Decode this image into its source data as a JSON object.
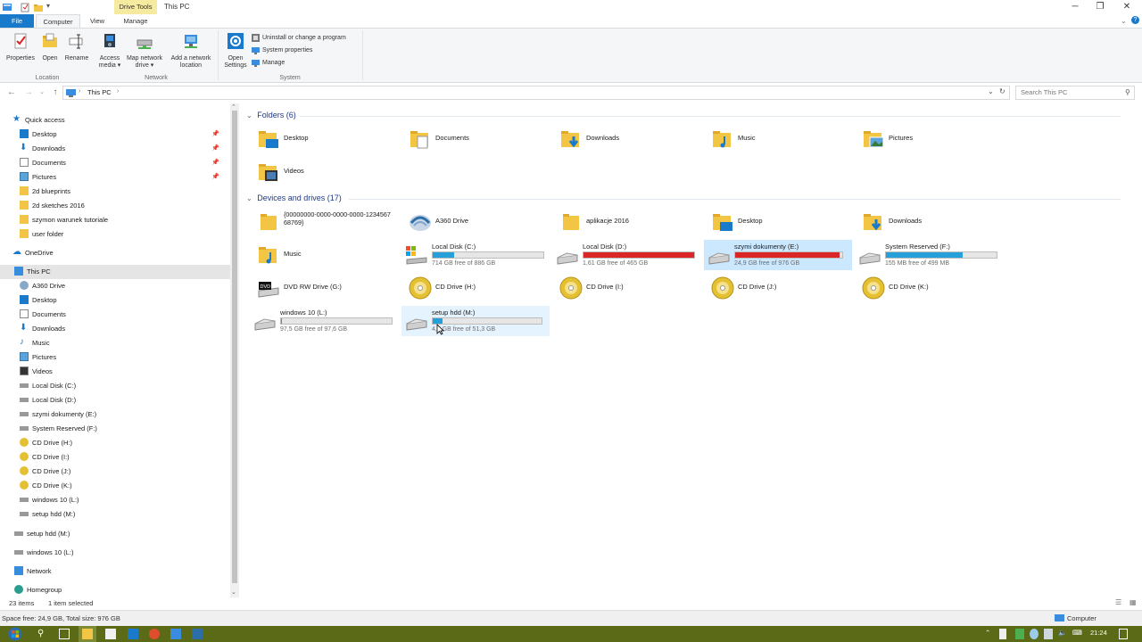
{
  "window": {
    "title": "This PC",
    "context_tab": "Drive Tools",
    "controls": [
      "─",
      "❐",
      "✕"
    ]
  },
  "ribbon_tabs": [
    "File",
    "Computer",
    "View",
    "Manage"
  ],
  "ribbon": {
    "buttons": [
      {
        "label": "Properties"
      },
      {
        "label": "Open"
      },
      {
        "label": "Rename"
      },
      {
        "label": "Access media ▾"
      },
      {
        "label": "Map network drive ▾"
      },
      {
        "label": "Add a network location"
      },
      {
        "label": "Open Settings"
      }
    ],
    "small": [
      "Uninstall or change a program",
      "System properties",
      "Manage"
    ],
    "groups": [
      "Location",
      "Network",
      "System"
    ]
  },
  "address": {
    "crumb": "This PC",
    "search_placeholder": "Search This PC"
  },
  "sidebar": {
    "quick_access": "Quick access",
    "quick_items": [
      "Desktop",
      "Downloads",
      "Documents",
      "Pictures",
      "2d blueprints",
      "2d sketches 2016",
      "szymon warunek tutoriale",
      "user folder"
    ],
    "onedrive": "OneDrive",
    "this_pc": "This PC",
    "pc_items": [
      "A360 Drive",
      "Desktop",
      "Documents",
      "Downloads",
      "Music",
      "Pictures",
      "Videos",
      "Local Disk (C:)",
      "Local Disk (D:)",
      "szymi dokumenty (E:)",
      "System Reserved (F:)",
      "CD Drive (H:)",
      "CD Drive (I:)",
      "CD Drive (J:)",
      "CD Drive (K:)",
      "windows 10 (L:)",
      "setup hdd (M:)"
    ],
    "extra_items": [
      "setup hdd (M:)",
      "windows 10 (L:)"
    ],
    "network": "Network",
    "homegroup": "Homegroup"
  },
  "folders": {
    "heading": "Folders (6)",
    "items": [
      "Desktop",
      "Documents",
      "Downloads",
      "Music",
      "Pictures",
      "Videos"
    ]
  },
  "devices": {
    "heading": "Devices and drives (17)",
    "row1": [
      "{00000000-0000-0000-0000-123456768769}",
      "A360 Drive",
      "aplikacje 2016",
      "Desktop",
      "Downloads"
    ],
    "row1_label1": "{00000000-0000-0000-0000-1234567",
    "row1_label1b": "68769}",
    "music": "Music",
    "drives": [
      {
        "name": "Local Disk (C:)",
        "free": "714 GB free of 886 GB",
        "used": 0.19,
        "color": "#26a0da"
      },
      {
        "name": "Local Disk (D:)",
        "free": "1,61 GB free of 465 GB",
        "used": 0.997,
        "color": "#da2626"
      },
      {
        "name": "szymi dokumenty (E:)",
        "free": "24,9 GB free of 976 GB",
        "used": 0.975,
        "color": "#da2626"
      },
      {
        "name": "System Reserved (F:)",
        "free": "155 MB free of 499 MB",
        "used": 0.69,
        "color": "#26a0da"
      },
      {
        "name": "windows 10 (L:)",
        "free": "97,5 GB free of 97,6 GB",
        "used": 0.001,
        "color": "#26a0da"
      },
      {
        "name": "setup hdd (M:)",
        "free": "4,6 GB free of 51,3 GB",
        "used": 0.09,
        "color": "#26a0da"
      }
    ],
    "dvd": "DVD RW Drive (G:)",
    "cds": [
      "CD Drive (H:)",
      "CD Drive (I:)",
      "CD Drive (J:)",
      "CD Drive (K:)"
    ]
  },
  "status": {
    "items": "23 items",
    "selected": "1 item selected"
  },
  "details": {
    "left": "Space free: 24,9 GB, Total size: 976 GB",
    "right": "Computer"
  },
  "taskbar": {
    "clock": "21:24"
  },
  "colors": {
    "accent": "#1979ca",
    "bar_blue": "#26a0da",
    "bar_red": "#da2626",
    "folder": "#f3c544",
    "taskbar": "#5b6a17"
  }
}
